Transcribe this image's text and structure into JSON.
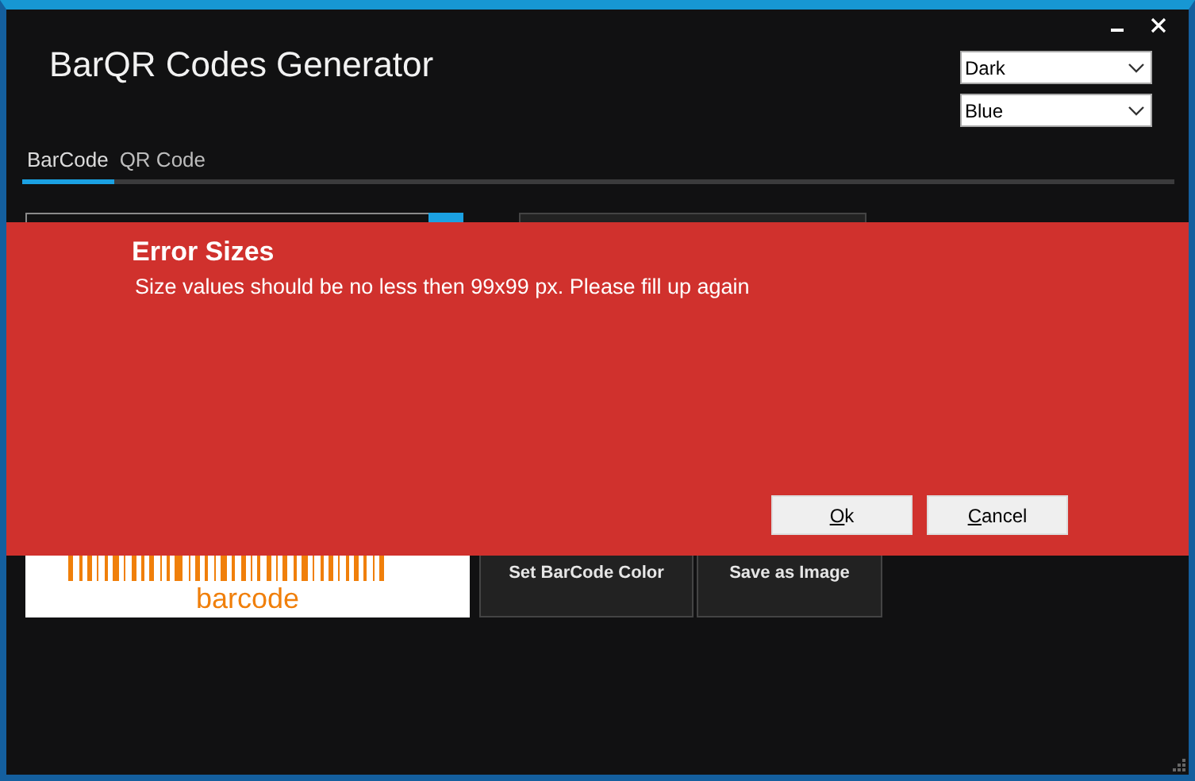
{
  "window": {
    "title": "BarQR Codes Generator"
  },
  "theme_selects": [
    {
      "value": "Dark"
    },
    {
      "value": "Blue"
    }
  ],
  "tabs": [
    {
      "label": "BarCode",
      "selected": true
    },
    {
      "label": "QR Code",
      "selected": false
    }
  ],
  "barcode": {
    "caption": "barcode"
  },
  "buttons": [
    "Set BarCode Color",
    "Save as Image"
  ],
  "dialog": {
    "title": "Error Sizes",
    "message": "Size values should be no less then 99x99 px. Please fill up again",
    "buttons": [
      "Ok",
      "Cancel"
    ]
  }
}
